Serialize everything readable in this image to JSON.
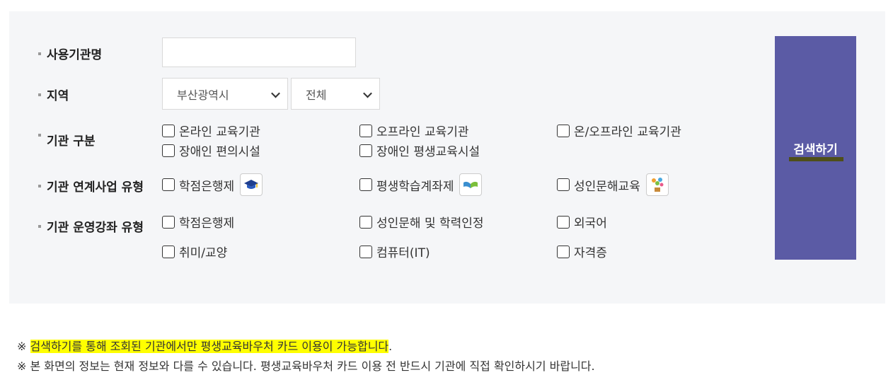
{
  "form": {
    "org_name_label": "사용기관명",
    "org_name_value": "",
    "region_label": "지역",
    "region_city": "부산광역시",
    "region_district": "전체",
    "org_type_label": "기관 구분",
    "org_type_options": [
      "온라인 교육기관",
      "오프라인 교육기관",
      "온/오프라인 교육기관",
      "장애인 편의시설",
      "장애인 평생교육시설"
    ],
    "linked_biz_label": "기관 연계사업 유형",
    "linked_biz_options": [
      "학점은행제",
      "평생학습계좌제",
      "성인문해교육"
    ],
    "course_type_label": "기관 운영강좌 유형",
    "course_type_options": [
      "학점은행제",
      "성인문해 및 학력인정",
      "외국어",
      "취미/교양",
      "컴퓨터(IT)",
      "자격증"
    ],
    "search_button": "검색하기"
  },
  "notes": {
    "mark": "※",
    "line1_highlight": "검색하기를 통해 조회된 기관에서만 평생교육바우처 카드 이용이 가능합니다",
    "line1_end": ".",
    "line2": "본 화면의 정보는 현재 정보와 다를 수 있습니다. 평생교육바우처 카드 이용 전 반드시 기관에 직접 확인하시기 바랍니다."
  },
  "colors": {
    "panel_bg": "#f5f6f8",
    "button_bg": "#5b5ba5",
    "highlight": "#ffff00"
  }
}
